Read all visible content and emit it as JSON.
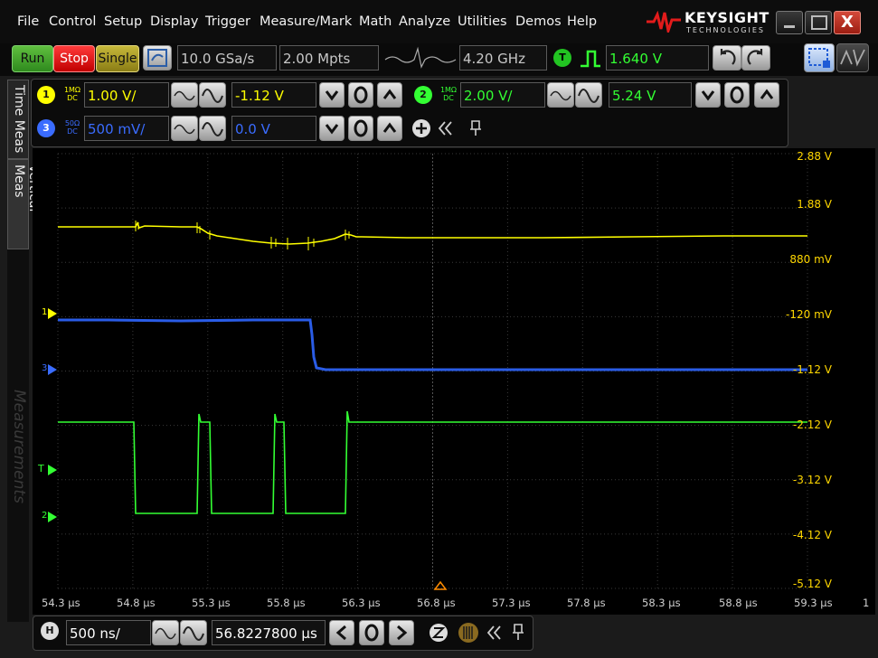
{
  "menu": [
    "File",
    "Control",
    "Setup",
    "Display",
    "Trigger",
    "Measure/Mark",
    "Math",
    "Analyze",
    "Utilities",
    "Demos",
    "Help"
  ],
  "brand": {
    "name": "KEYSIGHT",
    "sub": "TECHNOLOGIES"
  },
  "window": {
    "close_label": "X"
  },
  "acquisition": {
    "run_label": "Run",
    "stop_label": "Stop",
    "single_label": "Single",
    "sample_rate": "10.0 GSa/s",
    "memory_depth": "2.00 Mpts",
    "bandwidth": "4.20 GHz",
    "trigger_label": "T",
    "trigger_level": "1.640 V"
  },
  "channels": {
    "ch1": {
      "number": "1",
      "impedance": "1MΩ",
      "coupling": "DC",
      "scale": "1.00 V/",
      "offset": "-1.12 V",
      "color": "#ffff00"
    },
    "ch2": {
      "number": "2",
      "impedance": "1MΩ",
      "coupling": "DC",
      "scale": "2.00 V/",
      "offset": "5.24 V",
      "color": "#33ff33"
    },
    "ch3": {
      "number": "3",
      "impedance": "50Ω",
      "coupling": "DC",
      "scale": "500 mV/",
      "offset": "0.0 V",
      "color": "#3a6cff"
    }
  },
  "side_tabs": [
    "Time Meas",
    "Vertical Meas",
    "Measurements"
  ],
  "y_axis_labels": [
    "2.88 V",
    "1.88 V",
    "880 mV",
    "-120 mV",
    "-1.12 V",
    "-2.12 V",
    "-3.12 V",
    "-4.12 V",
    "-5.12 V"
  ],
  "x_axis_labels": [
    "54.3 µs",
    "54.8 µs",
    "55.3 µs",
    "55.8 µs",
    "56.3 µs",
    "56.8 µs",
    "57.3 µs",
    "57.8 µs",
    "58.3 µs",
    "58.8 µs",
    "59.3 µs"
  ],
  "x_axis_end_label": "1",
  "marker_labels": {
    "ch1": "1",
    "ch3": "3",
    "trigger": "T",
    "ch2": "2"
  },
  "horizontal": {
    "label": "H",
    "timebase": "500 ns/",
    "position": "56.8227800 µs"
  }
}
